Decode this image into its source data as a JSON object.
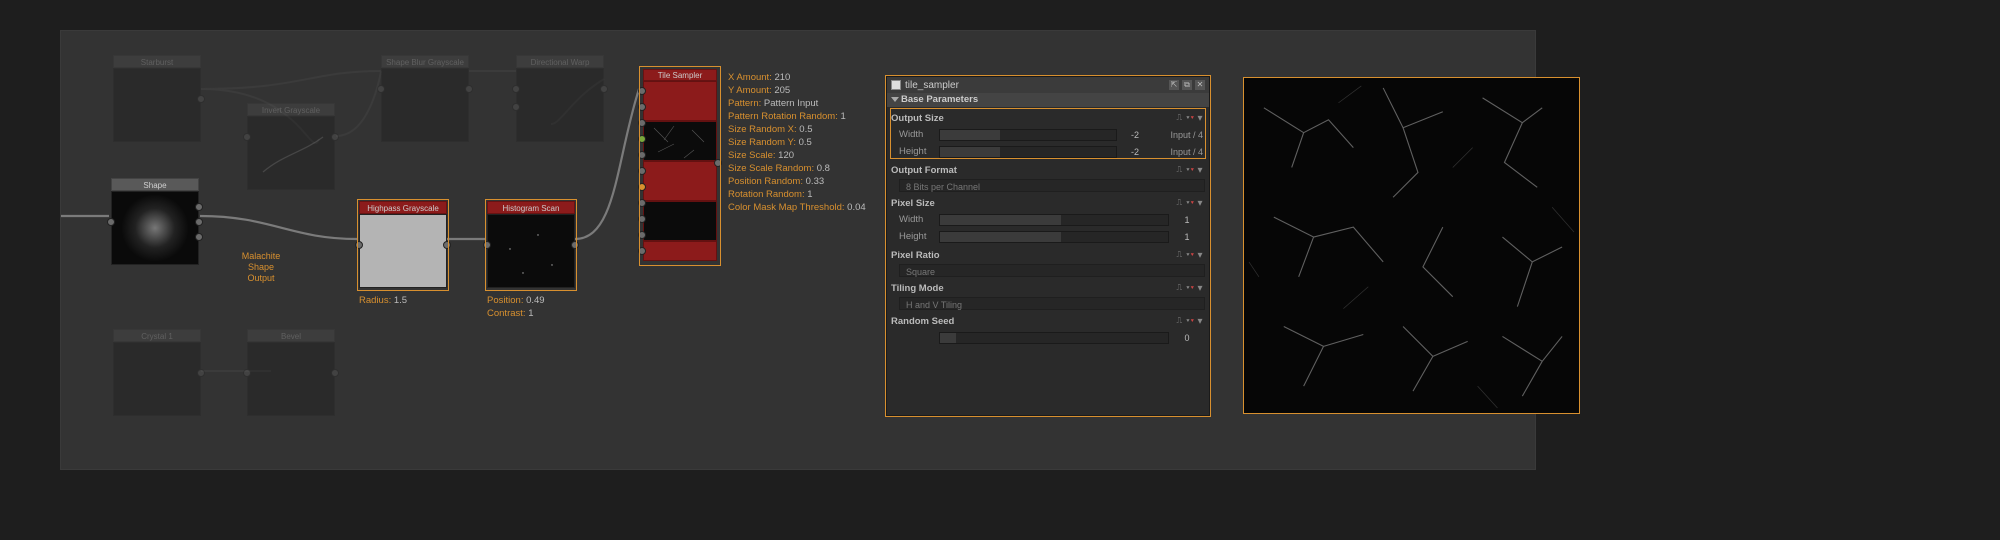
{
  "nodes": {
    "starburst": {
      "label": "Starburst"
    },
    "shape_blur": {
      "label": "Shape Blur Grayscale"
    },
    "dir_warp": {
      "label": "Directional Warp"
    },
    "invert": {
      "label": "Invert Grayscale"
    },
    "shape": {
      "label": "Shape"
    },
    "crystal": {
      "label": "Crystal 1"
    },
    "bevel": {
      "label": "Bevel"
    },
    "highpass": {
      "label": "Highpass Grayscale"
    },
    "histogram": {
      "label": "Histogram Scan"
    },
    "tile_sampler": {
      "label": "Tile Sampler"
    }
  },
  "annotations": {
    "malachite": "Malachite\nShape\nOutput",
    "highpass": [
      {
        "k": "Radius",
        "v": "1.5"
      }
    ],
    "histogram": [
      {
        "k": "Position",
        "v": "0.49"
      },
      {
        "k": "Contrast",
        "v": "1"
      }
    ],
    "tile_sampler": [
      {
        "k": "X Amount",
        "v": "210"
      },
      {
        "k": "Y Amount",
        "v": "205"
      },
      {
        "k": "Pattern",
        "v": "Pattern Input"
      },
      {
        "k": "Pattern Rotation Random",
        "v": "1"
      },
      {
        "k": "Size Random X",
        "v": "0.5"
      },
      {
        "k": "Size Random Y",
        "v": "0.5"
      },
      {
        "k": "Size Scale",
        "v": "120"
      },
      {
        "k": "Size Scale Random",
        "v": "0.8"
      },
      {
        "k": "Position Random",
        "v": "0.33"
      },
      {
        "k": "Rotation Random",
        "v": "1"
      },
      {
        "k": "Color Mask Map Threshold",
        "v": "0.04"
      }
    ]
  },
  "panel": {
    "title": "tile_sampler",
    "section": "Base Parameters",
    "groups": [
      {
        "name": "Output Size",
        "rows": [
          {
            "lbl": "Width",
            "val": "-2",
            "suffix": "Input / 4",
            "fill": 0.34
          },
          {
            "lbl": "Height",
            "val": "-2",
            "suffix": "Input / 4",
            "fill": 0.34
          }
        ],
        "highlight": true
      },
      {
        "name": "Output Format",
        "readonly": "8 Bits per Channel"
      },
      {
        "name": "Pixel Size",
        "rows": [
          {
            "lbl": "Width",
            "val": "1",
            "suffix": "",
            "fill": 0.53
          },
          {
            "lbl": "Height",
            "val": "1",
            "suffix": "",
            "fill": 0.53
          }
        ]
      },
      {
        "name": "Pixel Ratio",
        "readonly": "Square"
      },
      {
        "name": "Tiling Mode",
        "readonly": "H and V Tiling"
      },
      {
        "name": "Random Seed",
        "rows": [
          {
            "lbl": "",
            "val": "0",
            "suffix": "",
            "fill": 0.07
          }
        ]
      }
    ]
  },
  "icons": {
    "group_controls": "⎍ ▾ ▾"
  }
}
